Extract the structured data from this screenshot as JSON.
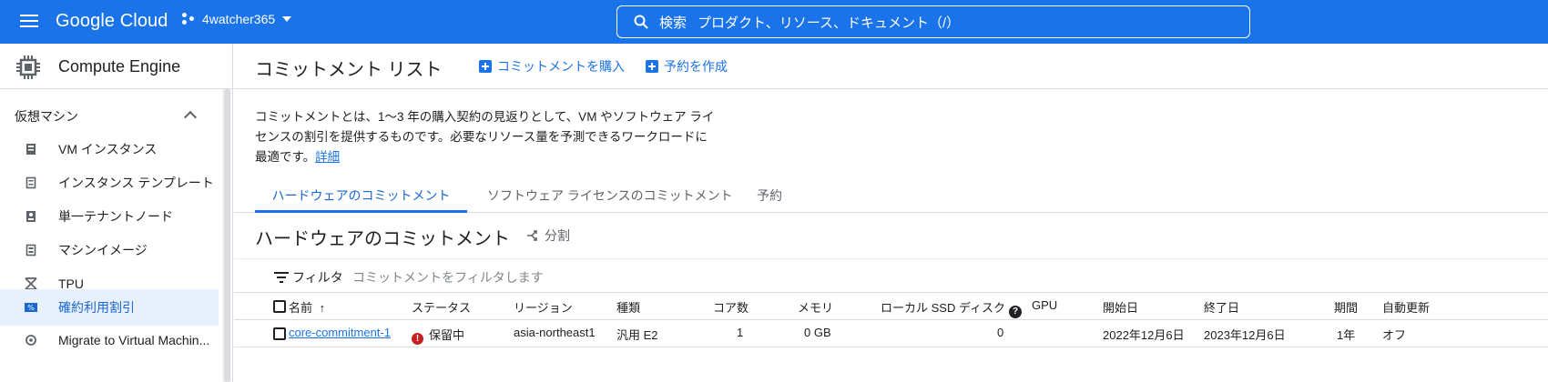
{
  "colors": {
    "topbar": "#1a73e8",
    "accent": "#1a73e8",
    "status_error": "#c5221f"
  },
  "topbar": {
    "logo": "Google Cloud",
    "project": "4watcher365",
    "search_label": "検索",
    "search_placeholder": "プロダクト、リソース、ドキュメント（/）"
  },
  "nav": {
    "product": "Compute Engine",
    "section": "仮想マシン",
    "items": [
      {
        "label": "VM インスタンス",
        "icon": "vm-icon"
      },
      {
        "label": "インスタンス テンプレート",
        "icon": "template-icon"
      },
      {
        "label": "単一テナントノード",
        "icon": "node-icon"
      },
      {
        "label": "マシンイメージ",
        "icon": "image-icon"
      },
      {
        "label": "TPU",
        "icon": "tpu-icon"
      },
      {
        "label": "確約利用割引",
        "icon": "percent-icon",
        "active": true
      },
      {
        "label": "Migrate to Virtual Machin...",
        "icon": "migrate-icon"
      }
    ]
  },
  "header": {
    "title": "コミットメント リスト",
    "buy_commitment": "コミットメントを購入",
    "create_reservation": "予約を作成"
  },
  "description": {
    "text": "コミットメントとは、1〜3 年の購入契約の見返りとして、VM やソフトウェア ライセンスの割引を提供するものです。必要なリソース量を予測できるワークロードに最適です。",
    "link": "詳細"
  },
  "tabs": [
    "ハードウェアのコミットメント",
    "ソフトウェア ライセンスのコミットメント",
    "予約"
  ],
  "section": {
    "title": "ハードウェアのコミットメント",
    "split": "分割"
  },
  "filter": {
    "label": "フィルタ",
    "placeholder": "コミットメントをフィルタします"
  },
  "table": {
    "columns": [
      "名前",
      "ステータス",
      "リージョン",
      "種類",
      "コア数",
      "メモリ",
      "ローカル SSD ディスク",
      "GPU",
      "開始日",
      "終了日",
      "期間",
      "自動更新"
    ],
    "rows": [
      {
        "name": "core-commitment-1",
        "status": "保留中",
        "region": "asia-northeast1",
        "type": "汎用 E2",
        "cores": "1",
        "memory": "0 GB",
        "ssd": "0",
        "gpu": "",
        "start": "2022年12月6日",
        "end": "2023年12月6日",
        "term": "1年",
        "auto_renew": "オフ"
      }
    ]
  }
}
